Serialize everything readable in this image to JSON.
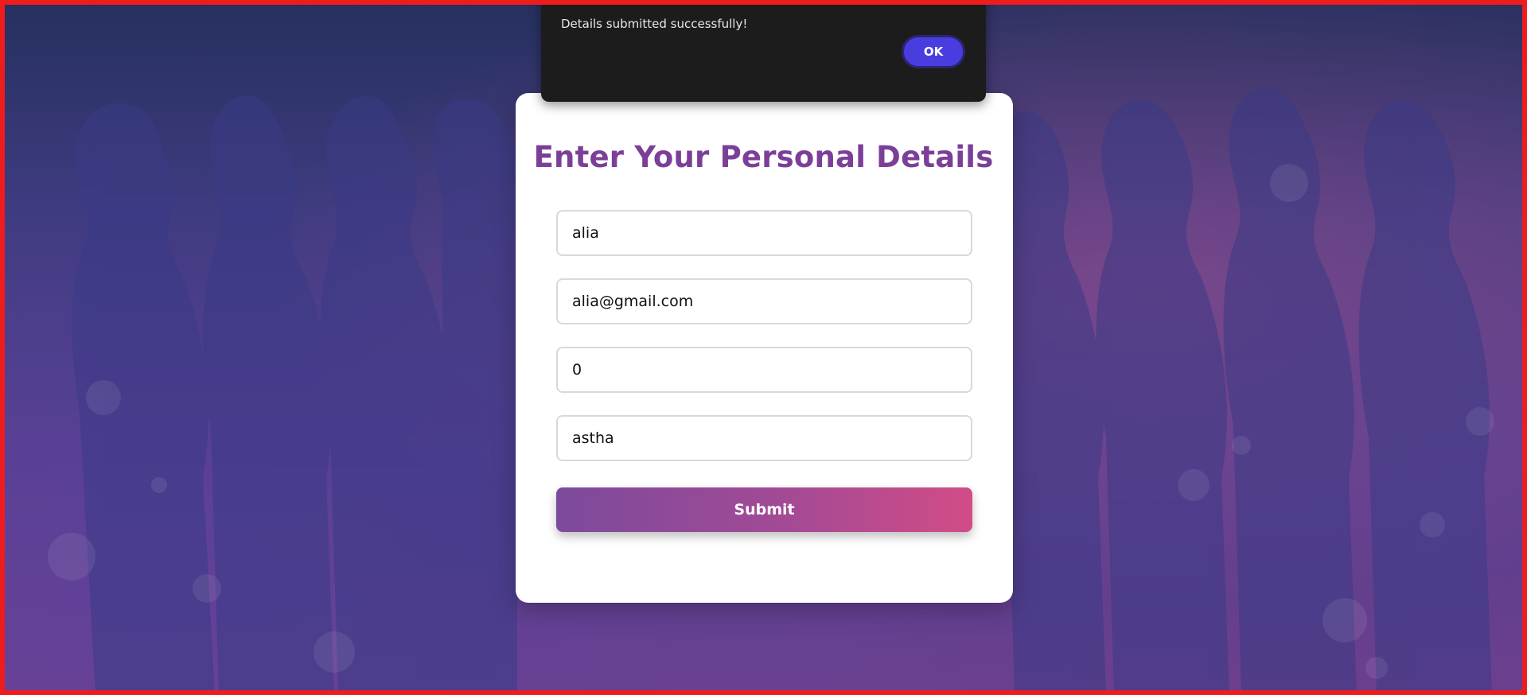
{
  "dialog": {
    "message": "Details submitted successfully!",
    "ok_label": "OK"
  },
  "form": {
    "title": "Enter Your Personal Details",
    "fields": [
      {
        "name": "name",
        "value": "alia"
      },
      {
        "name": "email",
        "value": "alia@gmail.com"
      },
      {
        "name": "phone",
        "value": "0"
      },
      {
        "name": "city",
        "value": "astha"
      }
    ],
    "submit_label": "Submit"
  },
  "colors": {
    "title": "#7b3f98",
    "frame_border": "#ee1c1c",
    "ok_button": "#4a3de0",
    "submit_gradient_start": "#7c4a9c",
    "submit_gradient_end": "#d24c86"
  }
}
